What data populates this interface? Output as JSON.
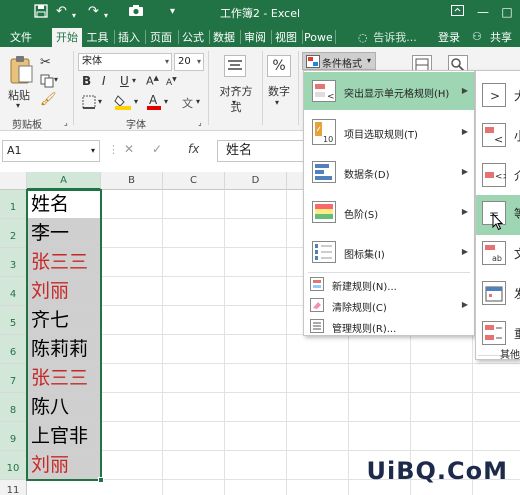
{
  "titlebar": {
    "title": "工作簿2 - Excel",
    "qa_save_icon": "save-icon",
    "qa_undo_icon": "undo-icon",
    "qa_redo_icon": "redo-icon",
    "qa_camera_icon": "camera-icon",
    "qa_more_icon": "customize-quick-access-icon",
    "ribbon_options_icon": "ribbon-display-options-icon",
    "minimize": "—",
    "restore": "□"
  },
  "tabs": {
    "items": [
      "文件",
      "开始",
      "工具",
      "插入",
      "页面",
      "公式",
      "数据",
      "审阅",
      "视图",
      "Powe"
    ],
    "active_index": 1,
    "tell_me": "告诉我...",
    "signin": "登录",
    "share": "共享"
  },
  "ribbon": {
    "paste": "粘贴",
    "clipboard": "剪贴板",
    "font_name": "宋体",
    "font_size": "20",
    "bold": "B",
    "italic": "I",
    "underline": "U",
    "font_group": "字体",
    "alignment": "对齐方式",
    "number": "数字",
    "number_symbol": "%",
    "cond_format": "条件格式",
    "colors": {
      "accent": "#217346",
      "fill_bar": "#ffd200",
      "font_bar": "#e00000"
    }
  },
  "formula_bar": {
    "name_box": "A1",
    "fx": "fx",
    "content": "姓名"
  },
  "grid": {
    "columns": [
      "A",
      "B",
      "C",
      "D"
    ],
    "rows": [
      "1",
      "2",
      "3",
      "4",
      "5",
      "6",
      "7",
      "8",
      "9",
      "10",
      "11"
    ],
    "cells": [
      {
        "text": "姓名",
        "color": "#000000",
        "bg": "#ffffff"
      },
      {
        "text": "李一",
        "color": "#000000",
        "bg": "#cfcfcf"
      },
      {
        "text": "张三三",
        "color": "#c62828",
        "bg": "#cfcfcf"
      },
      {
        "text": "刘丽",
        "color": "#c62828",
        "bg": "#cfcfcf"
      },
      {
        "text": "齐七",
        "color": "#000000",
        "bg": "#cfcfcf"
      },
      {
        "text": "陈莉莉",
        "color": "#000000",
        "bg": "#cfcfcf"
      },
      {
        "text": "张三三",
        "color": "#c62828",
        "bg": "#cfcfcf"
      },
      {
        "text": "陈八",
        "color": "#000000",
        "bg": "#cfcfcf"
      },
      {
        "text": "上官非",
        "color": "#000000",
        "bg": "#cfcfcf"
      },
      {
        "text": "刘丽",
        "color": "#c62828",
        "bg": "#cfcfcf"
      }
    ]
  },
  "cf_menu": {
    "items": [
      {
        "label": "突出显示单元格规则(H)",
        "icon": "highlight-rules-icon",
        "highlighted": true
      },
      {
        "label": "项目选取规则(T)",
        "icon": "top-bottom-rules-icon",
        "highlighted": false
      },
      {
        "label": "数据条(D)",
        "icon": "data-bars-icon",
        "highlighted": false
      },
      {
        "label": "色阶(S)",
        "icon": "color-scales-icon",
        "highlighted": false
      },
      {
        "label": "图标集(I)",
        "icon": "icon-sets-icon",
        "highlighted": false
      }
    ],
    "small_items": [
      {
        "label": "新建规则(N)...",
        "icon": "new-rule-icon"
      },
      {
        "label": "清除规则(C)",
        "icon": "clear-rules-icon"
      },
      {
        "label": "管理规则(R)...",
        "icon": "manage-rules-icon"
      }
    ]
  },
  "submenu": {
    "items": [
      {
        "label": "大",
        "icon": "greater-than-icon"
      },
      {
        "label": "小",
        "icon": "less-than-icon"
      },
      {
        "label": "介",
        "icon": "between-icon"
      },
      {
        "label": "等",
        "icon": "equal-to-icon"
      },
      {
        "label": "文",
        "icon": "text-contains-icon"
      },
      {
        "label": "发",
        "icon": "date-occurring-icon"
      },
      {
        "label": "重",
        "icon": "duplicate-values-icon"
      }
    ],
    "more": "其他"
  },
  "watermark": "UiBQ.CoM"
}
